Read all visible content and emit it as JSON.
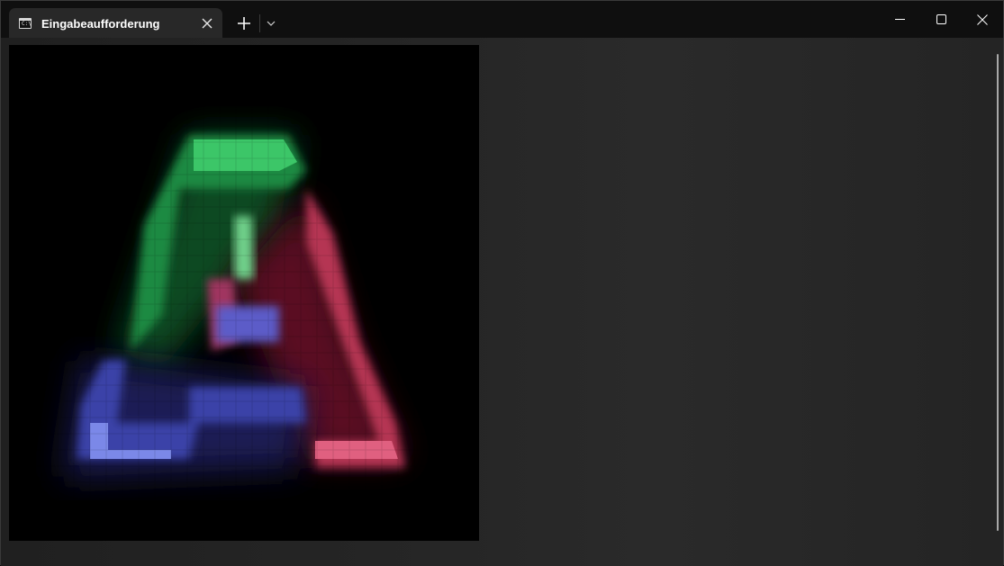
{
  "window": {
    "tab": {
      "title": "Eingabeaufforderung",
      "icon": "command-prompt-icon",
      "icon_glyph": "C:\\"
    },
    "controls": {
      "new_tab_icon": "plus-icon",
      "dropdown_icon": "chevron-down-icon",
      "minimize_icon": "minimize-icon",
      "maximize_icon": "maximize-icon",
      "close_icon": "close-icon"
    }
  },
  "content": {
    "image": {
      "description_colors": {
        "green": "#3bc36a",
        "red": "#d85a78",
        "blue": "#6b78d8"
      }
    }
  }
}
